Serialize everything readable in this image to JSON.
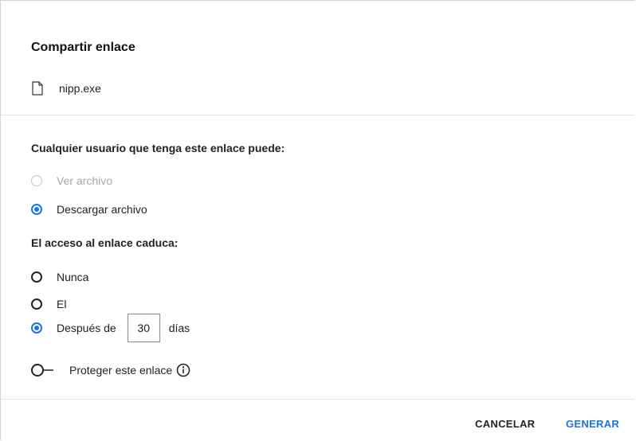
{
  "dialog": {
    "title": "Compartir enlace",
    "file_name": "nipp.exe",
    "permissions_label": "Cualquier usuario que tenga este enlace puede:",
    "permissions": [
      {
        "label": "Ver archivo",
        "selected": false,
        "disabled": true
      },
      {
        "label": "Descargar archivo",
        "selected": true,
        "disabled": false
      }
    ],
    "expiry_label": "El acceso al enlace caduca:",
    "expiry_options": [
      {
        "label": "Nunca",
        "selected": false
      },
      {
        "label": "El",
        "selected": false
      },
      {
        "label": "Después de",
        "selected": true,
        "days_value": "30",
        "suffix": "días"
      }
    ],
    "protect_label": "Proteger este enlace",
    "protect_enabled": false,
    "cancel_label": "CANCELAR",
    "generate_label": "GENERAR"
  },
  "colors": {
    "accent": "#1a73e8",
    "disabled_text": "#a8a8a8",
    "divider": "#e4e4e4"
  },
  "icons": {
    "file": "file-icon",
    "info": "info-icon"
  }
}
